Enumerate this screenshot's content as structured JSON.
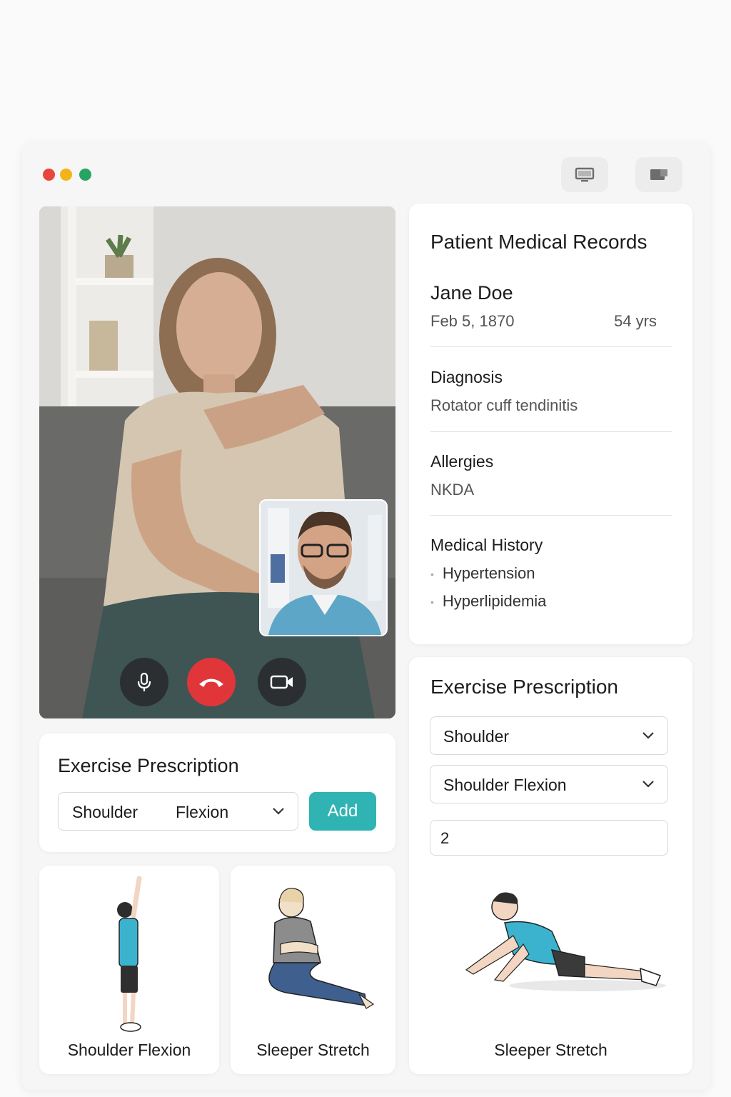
{
  "window": {
    "controls": [
      "close",
      "minimize",
      "maximize"
    ],
    "toolbar": {
      "screen_share_icon": "monitor-icon",
      "layout_icon": "window-layout-icon"
    }
  },
  "call": {
    "patient_video": "patient-video-feed",
    "doctor_video": "doctor-self-view",
    "controls": {
      "mic_icon": "microphone-icon",
      "end_icon": "end-call-icon",
      "camera_icon": "video-camera-icon",
      "end_color": "#e0363a"
    }
  },
  "prescription_left": {
    "title": "Exercise Prescription",
    "body_part": "Shoulder",
    "exercise": "Flexion",
    "add_label": "Add",
    "accent": "#2fb4b3"
  },
  "exercise_cards": [
    {
      "label": "Shoulder Flexion"
    },
    {
      "label": "Sleeper Stretch"
    }
  ],
  "records": {
    "title": "Patient Medical Records",
    "name": "Jane Doe",
    "dob": "Feb 5, 1870",
    "age": "54 yrs",
    "diagnosis_title": "Diagnosis",
    "diagnosis": "Rotator cuff tendinitis",
    "allergies_title": "Allergies",
    "allergies": "NKDA",
    "history_title": "Medical History",
    "history": [
      "Hypertension",
      "Hyperlipidemia"
    ]
  },
  "prescription_right": {
    "title": "Exercise Prescription",
    "body_part": "Shoulder",
    "exercise": "Shoulder Flexion",
    "quantity": "2",
    "preview_label": "Sleeper Stretch"
  }
}
